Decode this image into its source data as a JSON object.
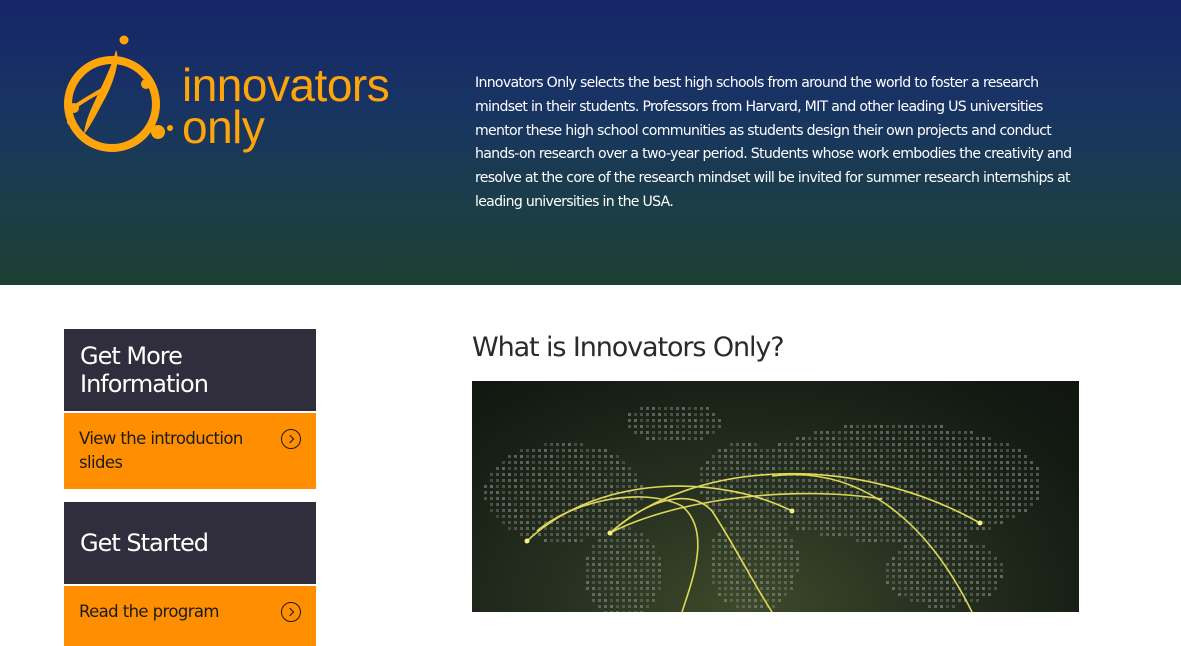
{
  "header": {
    "logo": {
      "line1": "innovators",
      "line2": "only",
      "color": "#ffa50a"
    },
    "intro_text": "Innovators Only selects the best high schools from around the world to foster a research mindset in their students. Professors from Harvard, MIT and other leading US universities mentor these high school communities as students design their own projects and conduct hands-on research over a two-year period. Students whose work embodies the creativity and resolve at the core of the research mindset will be invited for summer research internships at leading universities in the USA."
  },
  "sidebar": {
    "cards": [
      {
        "title": "Get More Information",
        "link_label": "View the introduction slides",
        "icon": "chevron-right-circle-icon"
      },
      {
        "title": "Get Started",
        "link_label": "Read the program",
        "icon": "chevron-right-circle-icon"
      }
    ]
  },
  "main": {
    "title": "What is Innovators Only?",
    "image_alt": "world-map-connections-image"
  },
  "colors": {
    "header_top": "#162569",
    "header_bottom": "#1c3f33",
    "card_head": "#302d3d",
    "card_link": "#ff8f00",
    "arc": "#e8e25a"
  }
}
